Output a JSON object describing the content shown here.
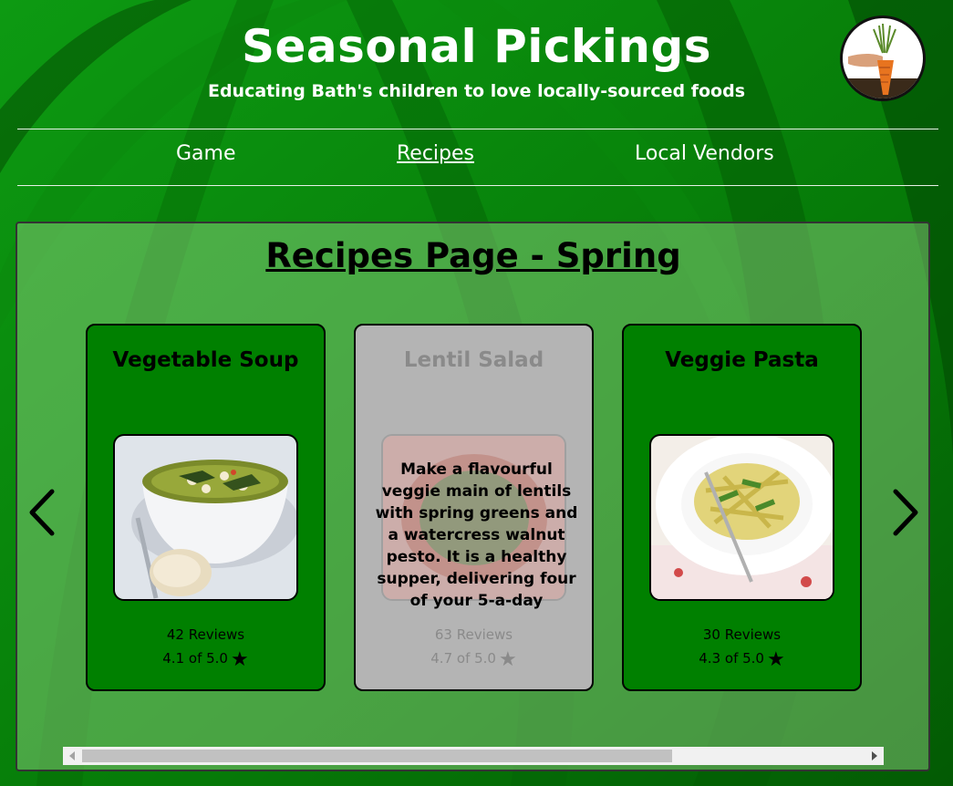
{
  "header": {
    "title": "Seasonal Pickings",
    "tagline": "Educating Bath's children to love locally-sourced foods",
    "logo_icon": "carrot-hand-logo"
  },
  "nav": {
    "items": [
      {
        "label": "Game",
        "active": false
      },
      {
        "label": "Recipes",
        "active": true
      },
      {
        "label": "Local Vendors",
        "active": false
      }
    ]
  },
  "main": {
    "title": "Recipes Page - Spring",
    "cards": [
      {
        "title": "Vegetable Soup",
        "image_icon": "vegetable-soup-photo",
        "reviews": "42 Reviews",
        "rating": "4.1 of 5.0",
        "description": ""
      },
      {
        "title": "Lentil Salad",
        "image_icon": "lentil-salad-photo",
        "reviews": "63 Reviews",
        "rating": "4.7 of 5.0",
        "description": "Make a flavourful veggie main of lentils with spring greens and a watercress walnut pesto. It is a healthy supper, delivering four of your 5-a-day"
      },
      {
        "title": "Veggie Pasta",
        "image_icon": "veggie-pasta-photo",
        "reviews": "30 Reviews",
        "rating": "4.3 of 5.0",
        "description": ""
      }
    ],
    "prev_icon": "chevron-left-icon",
    "next_icon": "chevron-right-icon"
  },
  "colors": {
    "background": "#0a7a0a",
    "card_green": "#008000",
    "card_dim": "#b4b4b4",
    "text_white": "#ffffff"
  }
}
